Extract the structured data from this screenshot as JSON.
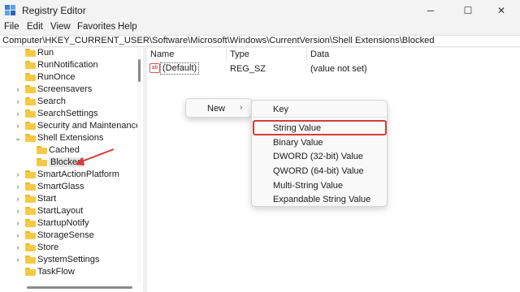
{
  "window": {
    "title": "Registry Editor",
    "app_icon": "regedit-icon",
    "controls": {
      "minimize": "─",
      "maximize": "☐",
      "close": "✕"
    }
  },
  "menubar": [
    "File",
    "Edit",
    "View",
    "Favorites",
    "Help"
  ],
  "address": "Computer\\HKEY_CURRENT_USER\\Software\\Microsoft\\Windows\\CurrentVersion\\Shell Extensions\\Blocked",
  "tree": {
    "items": [
      {
        "label": "Run",
        "expander": "",
        "level": 0
      },
      {
        "label": "RunNotification",
        "expander": "",
        "level": 0
      },
      {
        "label": "RunOnce",
        "expander": "",
        "level": 0
      },
      {
        "label": "Screensavers",
        "expander": "›",
        "level": 0
      },
      {
        "label": "Search",
        "expander": "›",
        "level": 0
      },
      {
        "label": "SearchSettings",
        "expander": "›",
        "level": 0
      },
      {
        "label": "Security and Maintenance",
        "expander": "›",
        "level": 0
      },
      {
        "label": "Shell Extensions",
        "expander": "⌄",
        "level": 0
      },
      {
        "label": "Cached",
        "expander": "",
        "level": 1
      },
      {
        "label": "Blocked",
        "expander": "",
        "level": 1,
        "selected": true
      },
      {
        "label": "SmartActionPlatform",
        "expander": "›",
        "level": 0
      },
      {
        "label": "SmartGlass",
        "expander": "›",
        "level": 0
      },
      {
        "label": "Start",
        "expander": "›",
        "level": 0
      },
      {
        "label": "StartLayout",
        "expander": "›",
        "level": 0
      },
      {
        "label": "StartupNotify",
        "expander": "›",
        "level": 0
      },
      {
        "label": "StorageSense",
        "expander": "›",
        "level": 0
      },
      {
        "label": "Store",
        "expander": "›",
        "level": 0
      },
      {
        "label": "SystemSettings",
        "expander": "›",
        "level": 0
      },
      {
        "label": "TaskFlow",
        "expander": "",
        "level": 0
      }
    ]
  },
  "list": {
    "columns": [
      "Name",
      "Type",
      "Data"
    ],
    "rows": [
      {
        "icon": "ab-icon",
        "icon_text": "ab",
        "name": "(Default)",
        "type": "REG_SZ",
        "data": "(value not set)"
      }
    ]
  },
  "context_menu": {
    "item": "New",
    "arrow": "›",
    "submenu": [
      "Key",
      "String Value",
      "Binary Value",
      "DWORD (32-bit) Value",
      "QWORD (64-bit) Value",
      "Multi-String Value",
      "Expandable String Value"
    ],
    "highlighted": "String Value"
  },
  "colors": {
    "annotation": "#d63b3b",
    "folder": "#f6c945",
    "selection": "#e5e5e5"
  }
}
